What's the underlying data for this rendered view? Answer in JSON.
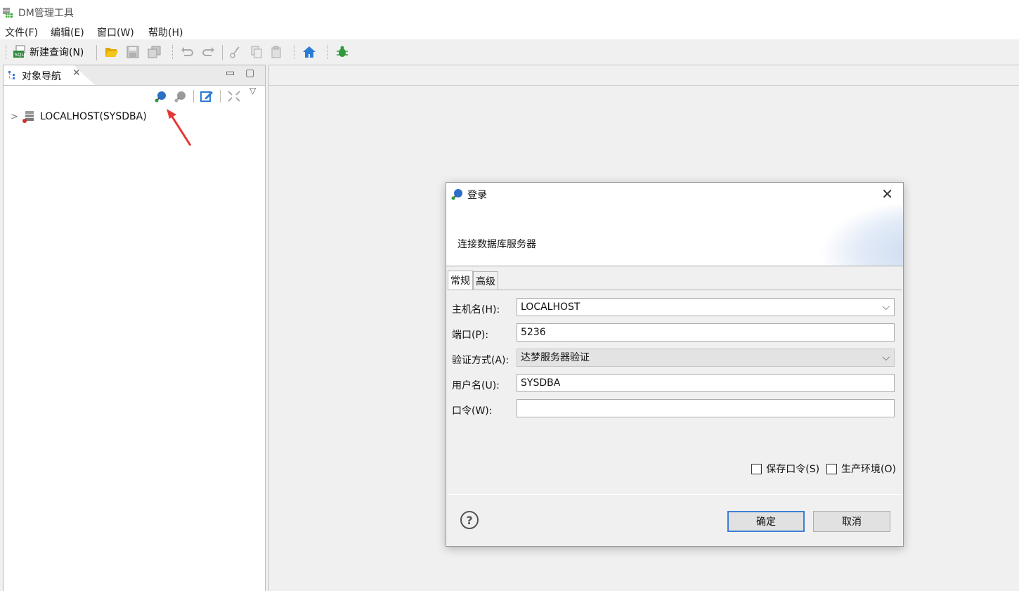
{
  "app": {
    "title": "DM管理工具"
  },
  "menu": [
    "文件(F)",
    "编辑(E)",
    "窗口(W)",
    "帮助(H)"
  ],
  "toolbar": {
    "new_query_label": "新建查询(N)"
  },
  "navigator": {
    "tab_label": "对象导航",
    "tree": [
      {
        "label": "LOCALHOST(SYSDBA)"
      }
    ]
  },
  "dialog": {
    "title": "登录",
    "banner": "连接数据库服务器",
    "tabs": [
      "常规",
      "高级"
    ],
    "fields": {
      "host": {
        "label": "主机名(H):",
        "value": "LOCALHOST"
      },
      "port": {
        "label": "端口(P):",
        "value": "5236"
      },
      "auth": {
        "label": "验证方式(A):",
        "value": "达梦服务器验证"
      },
      "user": {
        "label": "用户名(U):",
        "value": "SYSDBA"
      },
      "password": {
        "label": "口令(W):",
        "value": ""
      }
    },
    "save_password": "保存口令(S)",
    "production_env": "生产环境(O)",
    "ok": "确定",
    "cancel": "取消"
  }
}
